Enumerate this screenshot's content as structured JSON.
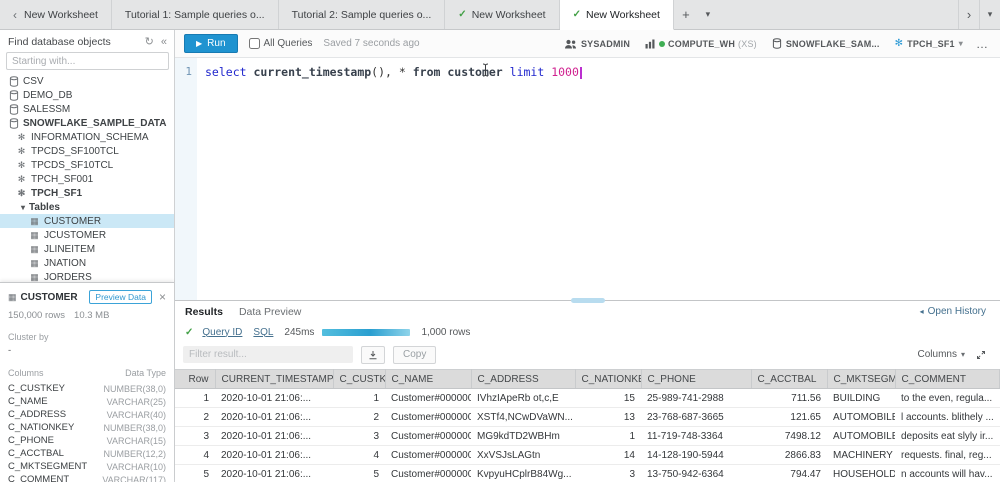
{
  "icons": {
    "back": "‹",
    "check": "✓",
    "add": "+",
    "caret_down": "▾",
    "scroll_right": "›",
    "refresh": "↻",
    "collapse": "«",
    "schema": "✻",
    "table": "▦",
    "close": "×",
    "play": "▶",
    "ellipsis": "…",
    "history_arrow": "◂"
  },
  "tabs": {
    "items": [
      {
        "label": "New Worksheet"
      },
      {
        "label": "Tutorial 1: Sample queries o..."
      },
      {
        "label": "Tutorial 2: Sample queries o..."
      },
      {
        "label": "New Worksheet"
      },
      {
        "label": "New Worksheet"
      }
    ]
  },
  "sidebar": {
    "title": "Find database objects",
    "search_placeholder": "Starting with...",
    "tree": [
      {
        "label": "CSV"
      },
      {
        "label": "DEMO_DB"
      },
      {
        "label": "SALESSM"
      },
      {
        "label": "SNOWFLAKE_SAMPLE_DATA"
      },
      {
        "label": "INFORMATION_SCHEMA"
      },
      {
        "label": "TPCDS_SF100TCL"
      },
      {
        "label": "TPCDS_SF10TCL"
      },
      {
        "label": "TPCH_SF001"
      },
      {
        "label": "TPCH_SF1"
      },
      {
        "label": "Tables"
      },
      {
        "label": "CUSTOMER"
      },
      {
        "label": "JCUSTOMER"
      },
      {
        "label": "JLINEITEM"
      },
      {
        "label": "JNATION"
      },
      {
        "label": "JORDERS"
      }
    ],
    "detail": {
      "title": "CUSTOMER",
      "preview_button": "Preview Data",
      "rows_count": "150,000 rows",
      "size": "10.3 MB",
      "cluster_by_label": "Cluster by",
      "cluster_by_value": "-",
      "columns_header": "Columns",
      "datatype_header": "Data Type",
      "columns": [
        {
          "name": "C_CUSTKEY",
          "type": "NUMBER(38,0)"
        },
        {
          "name": "C_NAME",
          "type": "VARCHAR(25)"
        },
        {
          "name": "C_ADDRESS",
          "type": "VARCHAR(40)"
        },
        {
          "name": "C_NATIONKEY",
          "type": "NUMBER(38,0)"
        },
        {
          "name": "C_PHONE",
          "type": "VARCHAR(15)"
        },
        {
          "name": "C_ACCTBAL",
          "type": "NUMBER(12,2)"
        },
        {
          "name": "C_MKTSEGMENT",
          "type": "VARCHAR(10)"
        },
        {
          "name": "C_COMMENT",
          "type": "VARCHAR(117)"
        }
      ]
    }
  },
  "toolbar": {
    "run_label": "Run",
    "all_queries_label": "All Queries",
    "saved_status": "Saved 7 seconds ago",
    "role": "SYSADMIN",
    "warehouse": "COMPUTE_WH",
    "warehouse_size": "(XS)",
    "database": "SNOWFLAKE_SAM...",
    "schema": "TPCH_SF1"
  },
  "editor": {
    "line_number": "1",
    "tokens": [
      {
        "text": "select ",
        "type": "keyword"
      },
      {
        "text": "current_timestamp",
        "type": "identifier"
      },
      {
        "text": "(), * ",
        "type": "plain"
      },
      {
        "text": "from ",
        "type": "identifier"
      },
      {
        "text": "customer ",
        "type": "identifier"
      },
      {
        "text": "limit ",
        "type": "keyword"
      },
      {
        "text": "1000",
        "type": "number"
      }
    ]
  },
  "results": {
    "tabs": [
      {
        "label": "Results"
      },
      {
        "label": "Data Preview"
      }
    ],
    "open_history_label": "Open History",
    "query_id_label": "Query ID",
    "sql_label": "SQL",
    "duration": "245ms",
    "row_count": "1,000 rows",
    "filter_placeholder": "Filter result...",
    "copy_label": "Copy",
    "columns_label": "Columns",
    "table": {
      "headers": [
        "Row",
        "CURRENT_TIMESTAMP",
        "C_CUSTKEY",
        "C_NAME",
        "C_ADDRESS",
        "C_NATIONKEY",
        "C_PHONE",
        "C_ACCTBAL",
        "C_MKTSEGMENT",
        "C_COMMENT"
      ],
      "rows": [
        [
          "1",
          "2020-10-01 21:06:...",
          "1",
          "Customer#000000...",
          "IVhzIApeRb ot,c,E",
          "15",
          "25-989-741-2988",
          "711.56",
          "BUILDING",
          "to the even, regula..."
        ],
        [
          "2",
          "2020-10-01 21:06:...",
          "2",
          "Customer#000000...",
          "XSTf4,NCwDVaWN...",
          "13",
          "23-768-687-3665",
          "121.65",
          "AUTOMOBILE",
          "l accounts. blithely ..."
        ],
        [
          "3",
          "2020-10-01 21:06:...",
          "3",
          "Customer#000000...",
          "MG9kdTD2WBHm",
          "1",
          "11-719-748-3364",
          "7498.12",
          "AUTOMOBILE",
          "deposits eat slyly ir..."
        ],
        [
          "4",
          "2020-10-01 21:06:...",
          "4",
          "Customer#000000...",
          "XxVSJsLAGtn",
          "14",
          "14-128-190-5944",
          "2866.83",
          "MACHINERY",
          "requests. final, reg..."
        ],
        [
          "5",
          "2020-10-01 21:06:...",
          "5",
          "Customer#000000...",
          "KvpyuHCplrB84Wg...",
          "3",
          "13-750-942-6364",
          "794.47",
          "HOUSEHOLD",
          "n accounts will hav..."
        ]
      ]
    }
  }
}
